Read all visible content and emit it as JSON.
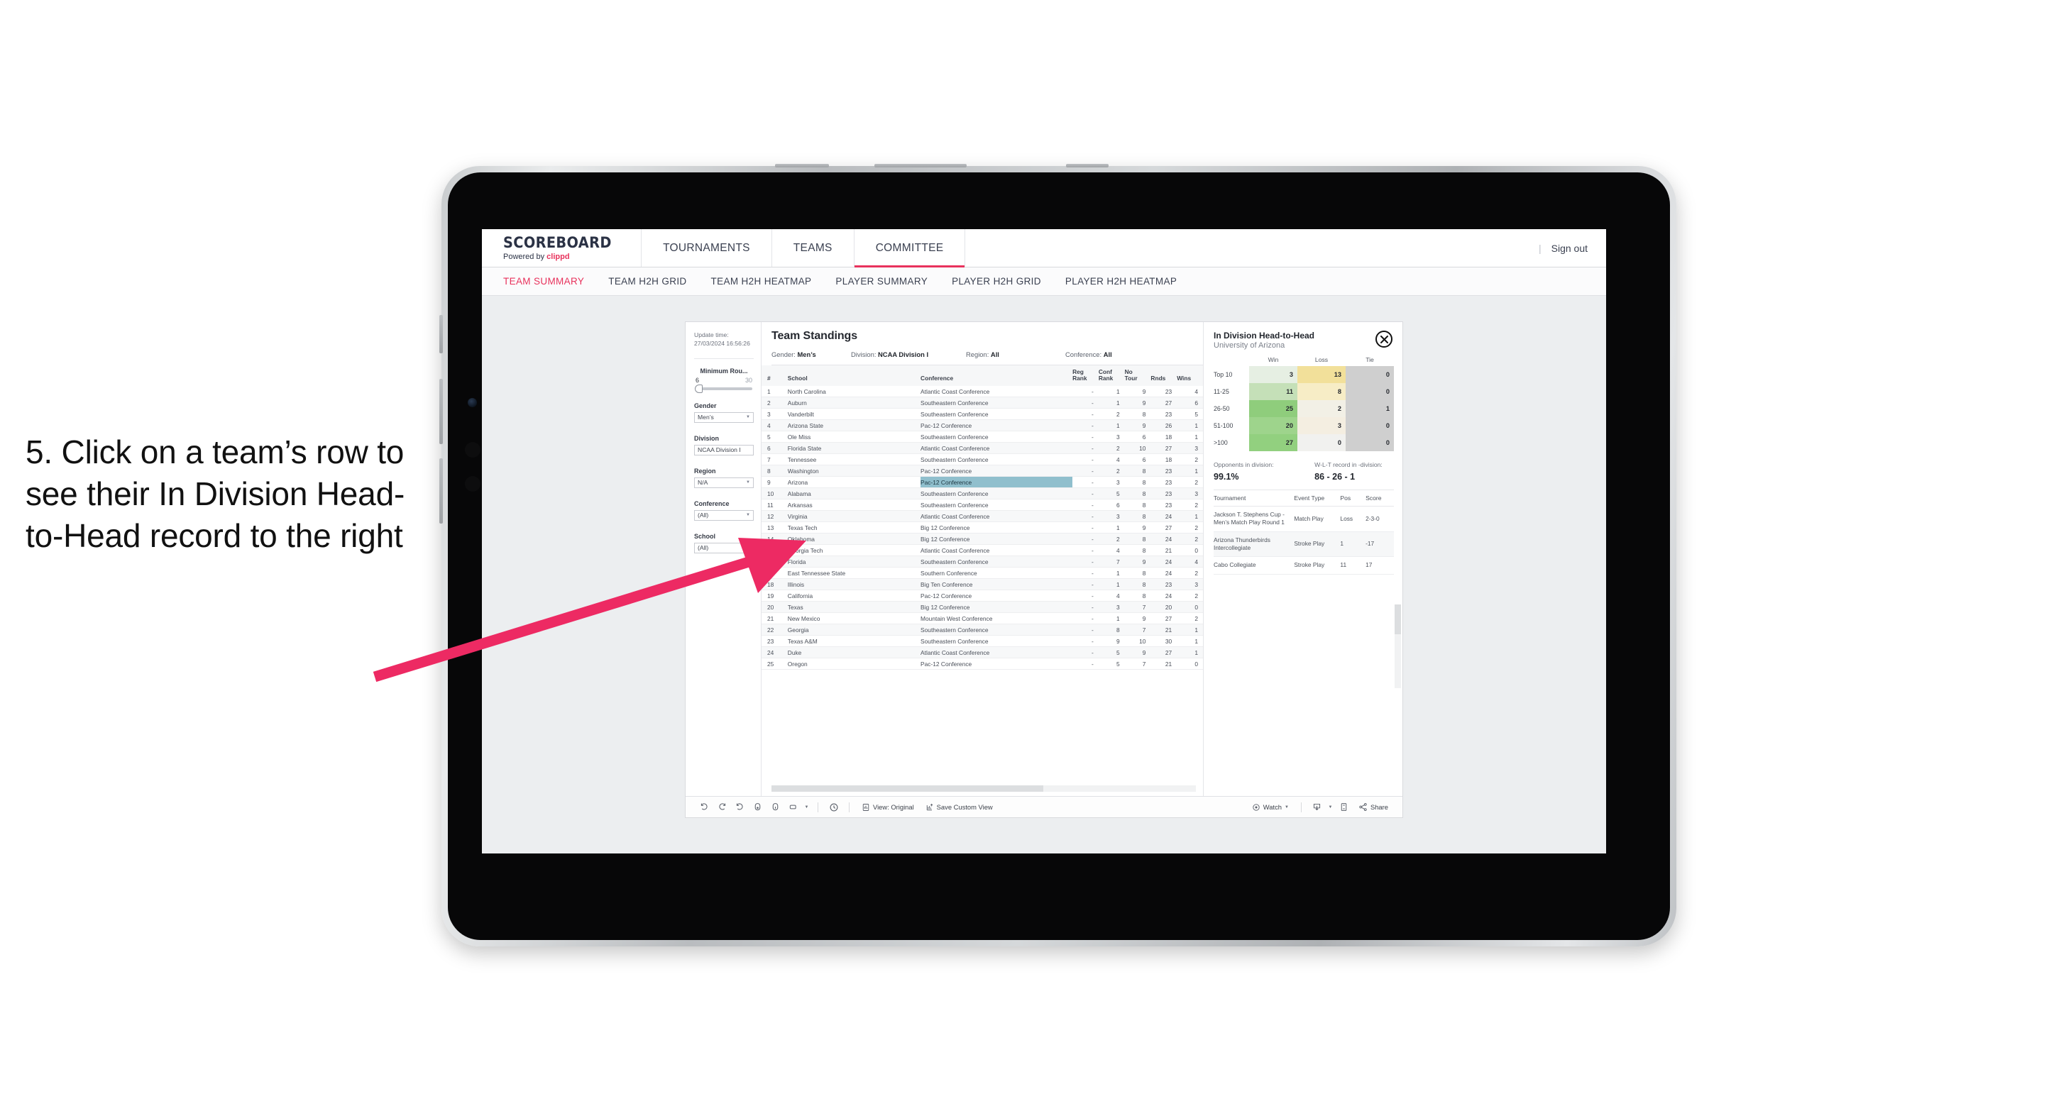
{
  "annotation": {
    "text": "5. Click on a team’s row to see their In Division Head-to-Head record to the right",
    "arrow_color": "#ED2A63"
  },
  "app": {
    "brand": {
      "title": "SCOREBOARD",
      "powered_prefix": "Powered by ",
      "powered_name": "clippd"
    },
    "topnav": [
      {
        "label": "TOURNAMENTS",
        "active": false
      },
      {
        "label": "TEAMS",
        "active": false
      },
      {
        "label": "COMMITTEE",
        "active": true
      }
    ],
    "topbar_right": {
      "separator": "|",
      "signout": "Sign out"
    },
    "subtabs": [
      {
        "label": "TEAM SUMMARY",
        "active": true
      },
      {
        "label": "TEAM H2H GRID",
        "active": false
      },
      {
        "label": "TEAM H2H HEATMAP",
        "active": false
      },
      {
        "label": "PLAYER SUMMARY",
        "active": false
      },
      {
        "label": "PLAYER H2H GRID",
        "active": false
      },
      {
        "label": "PLAYER H2H HEATMAP",
        "active": false
      }
    ]
  },
  "filters": {
    "update_time_label": "Update time:",
    "update_time_value": "27/03/2024 16:56:26",
    "slider": {
      "title": "Minimum Rou...",
      "min": "6",
      "max": "30"
    },
    "groups": [
      {
        "label": "Gender",
        "value": "Men’s"
      },
      {
        "label": "Division",
        "value": "NCAA Division I"
      },
      {
        "label": "Region",
        "value": "N/A"
      },
      {
        "label": "Conference",
        "value": "(All)"
      },
      {
        "label": "School",
        "value": "(All)"
      }
    ]
  },
  "standings": {
    "title": "Team Standings",
    "meta": [
      {
        "label": "Gender: ",
        "value": "Men’s"
      },
      {
        "label": "Division: ",
        "value": "NCAA Division I"
      },
      {
        "label": "Region: ",
        "value": "All"
      },
      {
        "label": "Conference: ",
        "value": "All"
      }
    ],
    "columns": [
      "#",
      "School",
      "Conference",
      "Reg Rank",
      "Conf Rank",
      "No Tour",
      "Rnds",
      "Wins"
    ],
    "selected_row": 9,
    "rows": [
      {
        "rank": "1",
        "school": "North Carolina",
        "conference": "Atlantic Coast Conference",
        "reg_rank": "-",
        "conf_rank": "1",
        "no_tour": "9",
        "rnds": "23",
        "wins": "4"
      },
      {
        "rank": "2",
        "school": "Auburn",
        "conference": "Southeastern Conference",
        "reg_rank": "-",
        "conf_rank": "1",
        "no_tour": "9",
        "rnds": "27",
        "wins": "6"
      },
      {
        "rank": "3",
        "school": "Vanderbilt",
        "conference": "Southeastern Conference",
        "reg_rank": "-",
        "conf_rank": "2",
        "no_tour": "8",
        "rnds": "23",
        "wins": "5"
      },
      {
        "rank": "4",
        "school": "Arizona State",
        "conference": "Pac-12 Conference",
        "reg_rank": "-",
        "conf_rank": "1",
        "no_tour": "9",
        "rnds": "26",
        "wins": "1"
      },
      {
        "rank": "5",
        "school": "Ole Miss",
        "conference": "Southeastern Conference",
        "reg_rank": "-",
        "conf_rank": "3",
        "no_tour": "6",
        "rnds": "18",
        "wins": "1"
      },
      {
        "rank": "6",
        "school": "Florida State",
        "conference": "Atlantic Coast Conference",
        "reg_rank": "-",
        "conf_rank": "2",
        "no_tour": "10",
        "rnds": "27",
        "wins": "3"
      },
      {
        "rank": "7",
        "school": "Tennessee",
        "conference": "Southeastern Conference",
        "reg_rank": "-",
        "conf_rank": "4",
        "no_tour": "6",
        "rnds": "18",
        "wins": "2"
      },
      {
        "rank": "8",
        "school": "Washington",
        "conference": "Pac-12 Conference",
        "reg_rank": "-",
        "conf_rank": "2",
        "no_tour": "8",
        "rnds": "23",
        "wins": "1"
      },
      {
        "rank": "9",
        "school": "Arizona",
        "conference": "Pac-12 Conference",
        "reg_rank": "-",
        "conf_rank": "3",
        "no_tour": "8",
        "rnds": "23",
        "wins": "2"
      },
      {
        "rank": "10",
        "school": "Alabama",
        "conference": "Southeastern Conference",
        "reg_rank": "-",
        "conf_rank": "5",
        "no_tour": "8",
        "rnds": "23",
        "wins": "3"
      },
      {
        "rank": "11",
        "school": "Arkansas",
        "conference": "Southeastern Conference",
        "reg_rank": "-",
        "conf_rank": "6",
        "no_tour": "8",
        "rnds": "23",
        "wins": "2"
      },
      {
        "rank": "12",
        "school": "Virginia",
        "conference": "Atlantic Coast Conference",
        "reg_rank": "-",
        "conf_rank": "3",
        "no_tour": "8",
        "rnds": "24",
        "wins": "1"
      },
      {
        "rank": "13",
        "school": "Texas Tech",
        "conference": "Big 12 Conference",
        "reg_rank": "-",
        "conf_rank": "1",
        "no_tour": "9",
        "rnds": "27",
        "wins": "2"
      },
      {
        "rank": "14",
        "school": "Oklahoma",
        "conference": "Big 12 Conference",
        "reg_rank": "-",
        "conf_rank": "2",
        "no_tour": "8",
        "rnds": "24",
        "wins": "2"
      },
      {
        "rank": "15",
        "school": "Georgia Tech",
        "conference": "Atlantic Coast Conference",
        "reg_rank": "-",
        "conf_rank": "4",
        "no_tour": "8",
        "rnds": "21",
        "wins": "0"
      },
      {
        "rank": "16",
        "school": "Florida",
        "conference": "Southeastern Conference",
        "reg_rank": "-",
        "conf_rank": "7",
        "no_tour": "9",
        "rnds": "24",
        "wins": "4"
      },
      {
        "rank": "17",
        "school": "East Tennessee State",
        "conference": "Southern Conference",
        "reg_rank": "-",
        "conf_rank": "1",
        "no_tour": "8",
        "rnds": "24",
        "wins": "2"
      },
      {
        "rank": "18",
        "school": "Illinois",
        "conference": "Big Ten Conference",
        "reg_rank": "-",
        "conf_rank": "1",
        "no_tour": "8",
        "rnds": "23",
        "wins": "3"
      },
      {
        "rank": "19",
        "school": "California",
        "conference": "Pac-12 Conference",
        "reg_rank": "-",
        "conf_rank": "4",
        "no_tour": "8",
        "rnds": "24",
        "wins": "2"
      },
      {
        "rank": "20",
        "school": "Texas",
        "conference": "Big 12 Conference",
        "reg_rank": "-",
        "conf_rank": "3",
        "no_tour": "7",
        "rnds": "20",
        "wins": "0"
      },
      {
        "rank": "21",
        "school": "New Mexico",
        "conference": "Mountain West Conference",
        "reg_rank": "-",
        "conf_rank": "1",
        "no_tour": "9",
        "rnds": "27",
        "wins": "2"
      },
      {
        "rank": "22",
        "school": "Georgia",
        "conference": "Southeastern Conference",
        "reg_rank": "-",
        "conf_rank": "8",
        "no_tour": "7",
        "rnds": "21",
        "wins": "1"
      },
      {
        "rank": "23",
        "school": "Texas A&M",
        "conference": "Southeastern Conference",
        "reg_rank": "-",
        "conf_rank": "9",
        "no_tour": "10",
        "rnds": "30",
        "wins": "1"
      },
      {
        "rank": "24",
        "school": "Duke",
        "conference": "Atlantic Coast Conference",
        "reg_rank": "-",
        "conf_rank": "5",
        "no_tour": "9",
        "rnds": "27",
        "wins": "1"
      },
      {
        "rank": "25",
        "school": "Oregon",
        "conference": "Pac-12 Conference",
        "reg_rank": "-",
        "conf_rank": "5",
        "no_tour": "7",
        "rnds": "21",
        "wins": "0"
      }
    ]
  },
  "h2h": {
    "title": "In Division Head-to-Head",
    "subtitle": "University of Arizona",
    "close_icon": "close-icon",
    "chart_data": {
      "type": "heatmap",
      "title": "In Division Head-to-Head",
      "subtitle": "University of Arizona",
      "columns": [
        "Win",
        "Loss",
        "Tie"
      ],
      "rows": [
        "Top 10",
        "11-25",
        "26-50",
        "51-100",
        ">100"
      ],
      "values": [
        [
          3,
          13,
          0
        ],
        [
          11,
          8,
          0
        ],
        [
          25,
          2,
          1
        ],
        [
          20,
          3,
          0
        ],
        [
          27,
          0,
          0
        ]
      ],
      "cell_colors": [
        [
          "#e6efe3",
          "#f2e09a",
          "#cfcfcf"
        ],
        [
          "#c5e0b8",
          "#f7edc6",
          "#cfcfcf"
        ],
        [
          "#8fcd7c",
          "#f2f0e6",
          "#cfcfcf"
        ],
        [
          "#9ed48c",
          "#f4eee1",
          "#cfcfcf"
        ],
        [
          "#92d07f",
          "#f1f1ef",
          "#cfcfcf"
        ]
      ],
      "colorscale_note": "green for wins, amber for losses, gray for ties"
    },
    "stats": [
      {
        "label": "Opponents in division:",
        "value": "99.1%"
      },
      {
        "label": "W-L-T record in -division:",
        "value": "86 - 26 - 1"
      }
    ],
    "tournaments": {
      "columns": [
        "Tournament",
        "Event Type",
        "Pos",
        "Score"
      ],
      "rows": [
        {
          "name": "Jackson T. Stephens Cup - Men’s Match Play Round 1",
          "event_type": "Match Play",
          "pos": "Loss",
          "score": "2-3-0"
        },
        {
          "name": "Arizona Thunderbirds Intercollegiate",
          "event_type": "Stroke Play",
          "pos": "1",
          "score": "-17"
        },
        {
          "name": "Cabo Collegiate",
          "event_type": "Stroke Play",
          "pos": "11",
          "score": "17"
        }
      ]
    }
  },
  "toolbar": {
    "icons": [
      "undo-icon",
      "redo-icon",
      "revert-icon",
      "pause-icon",
      "refresh-icon",
      "device-icon",
      "alert-icon"
    ],
    "view_label": "View: Original",
    "save_view_label": "Save Custom View",
    "watch_label": "Watch",
    "share_label": "Share"
  }
}
